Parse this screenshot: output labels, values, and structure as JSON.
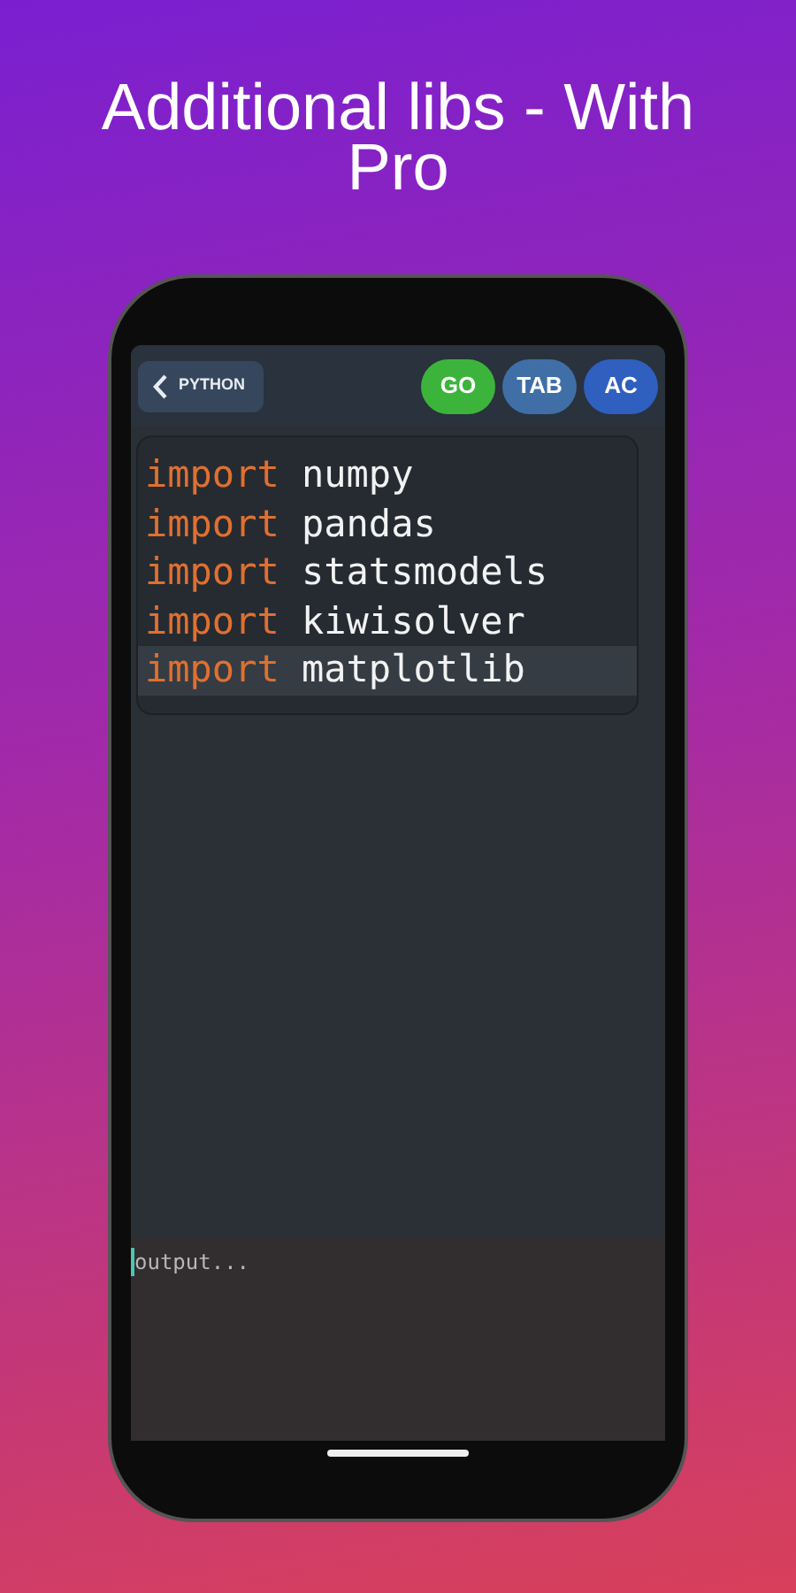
{
  "headline": "Additional libs -  With Pro",
  "toolbar": {
    "back_label": "PYTHON",
    "buttons": [
      {
        "label": "GO",
        "color": "#3cb43c"
      },
      {
        "label": "TAB",
        "color": "#3f6fa6"
      },
      {
        "label": "AC",
        "color": "#2f5fbf"
      }
    ]
  },
  "editor": {
    "lines": [
      {
        "keyword": "import",
        "module": "numpy",
        "current": false
      },
      {
        "keyword": "import",
        "module": "pandas",
        "current": false
      },
      {
        "keyword": "import",
        "module": "statsmodels",
        "current": false
      },
      {
        "keyword": "import",
        "module": "kiwisolver",
        "current": false
      },
      {
        "keyword": "import",
        "module": "matplotlib",
        "current": true
      }
    ]
  },
  "output": {
    "placeholder": "output..."
  }
}
